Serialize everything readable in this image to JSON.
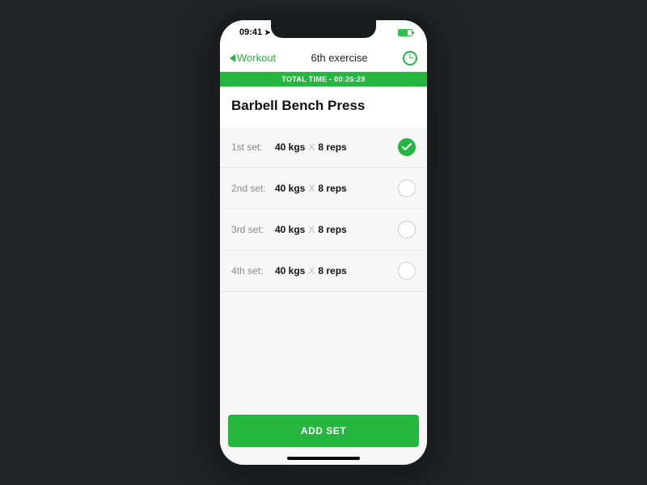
{
  "status": {
    "time": "09:41",
    "location_glyph": "➤"
  },
  "nav": {
    "back_label": "Workout",
    "title": "6th exercise"
  },
  "timer": {
    "text": "TOTAL TIME - 00:26:29"
  },
  "exercise": {
    "name": "Barbell Bench Press"
  },
  "sets": [
    {
      "label": "1st set:",
      "weight": "40 kgs",
      "reps": "8 reps",
      "done": true
    },
    {
      "label": "2nd set:",
      "weight": "40 kgs",
      "reps": "8 reps",
      "done": false
    },
    {
      "label": "3rd set:",
      "weight": "40 kgs",
      "reps": "8 reps",
      "done": false
    },
    {
      "label": "4th set:",
      "weight": "40 kgs",
      "reps": "8 reps",
      "done": false
    }
  ],
  "buttons": {
    "add_set": "ADD SET"
  },
  "glyphs": {
    "x": "X"
  }
}
